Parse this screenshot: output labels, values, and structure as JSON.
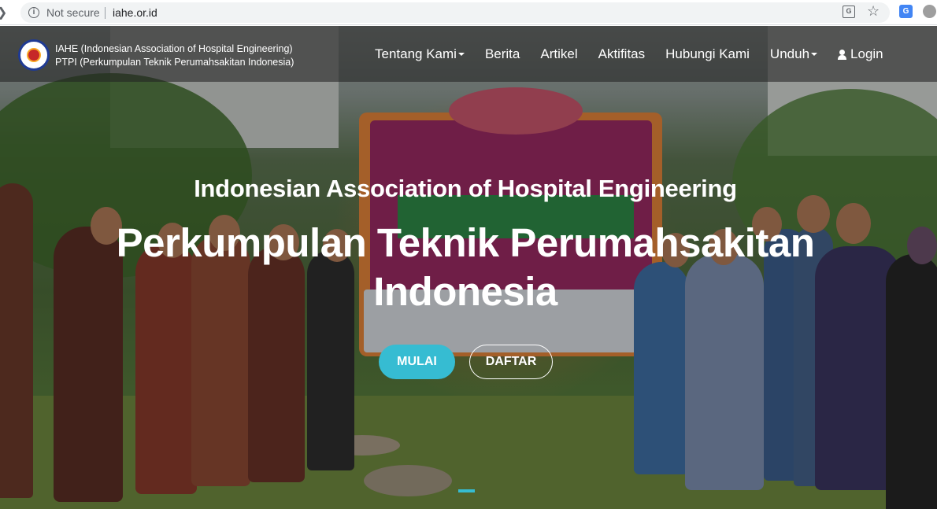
{
  "browser": {
    "security_label": "Not secure",
    "url": "iahe.or.id",
    "icons": [
      "back-arrow-icon",
      "info-icon",
      "translate-icon",
      "star-icon",
      "google-translate-extension-icon",
      "extension-icon"
    ]
  },
  "navbar": {
    "brand": {
      "line1": "IAHE (Indonesian Association of Hospital Engineering)",
      "line2": "PTPI (Perkumpulan Teknik Perumahsakitan Indonesia)"
    },
    "menu": [
      {
        "label": "Tentang Kami",
        "dropdown": true
      },
      {
        "label": "Berita",
        "dropdown": false
      },
      {
        "label": "Artikel",
        "dropdown": false
      },
      {
        "label": "Aktifitas",
        "dropdown": false
      },
      {
        "label": "Hubungi Kami",
        "dropdown": false
      },
      {
        "label": "Unduh",
        "dropdown": true
      }
    ],
    "login_label": "Login"
  },
  "hero": {
    "subtitle": "Indonesian Association of Hospital Engineering",
    "title": "Perkumpulan Teknik Perumahsakitan Indonesia",
    "primary_button": "MULAI",
    "secondary_button": "DAFTAR"
  },
  "colors": {
    "accent": "#36bcd2",
    "navbar_bg": "rgba(35,35,35,0.58)"
  }
}
